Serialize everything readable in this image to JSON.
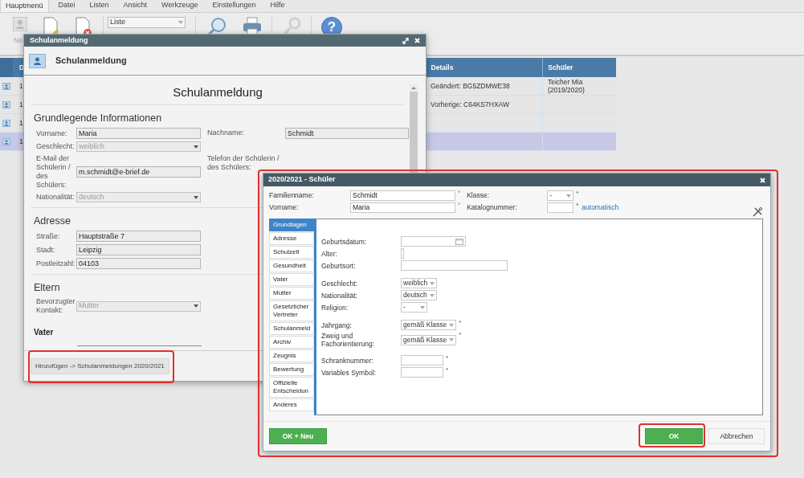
{
  "menu": [
    {
      "label": "Hauptmenü",
      "selected": true
    },
    {
      "label": "Datei",
      "selected": false
    },
    {
      "label": "Listen",
      "selected": false
    },
    {
      "label": "Ansicht",
      "selected": false
    },
    {
      "label": "Werkzeuge",
      "selected": false
    },
    {
      "label": "Einstellungen",
      "selected": false
    },
    {
      "label": "Hilfe",
      "selected": false
    }
  ],
  "toolbar": {
    "groups": [
      [
        {
          "kind": "new-person",
          "disabled": true,
          "label": "Ne"
        },
        {
          "kind": "edit",
          "disabled": false
        },
        {
          "kind": "delete",
          "disabled": false
        }
      ],
      [
        {
          "kind": "dropdown",
          "value": "Liste"
        }
      ],
      [
        {
          "kind": "search",
          "disabled": false
        },
        {
          "kind": "print",
          "disabled": false
        }
      ],
      [
        {
          "kind": "key",
          "disabled": true
        }
      ],
      [
        {
          "kind": "help",
          "disabled": false,
          "glyph": "?"
        }
      ]
    ]
  },
  "table": {
    "columns": {
      "column_2": "D",
      "details": "Details",
      "schueler": "Schüler"
    },
    "rows": [
      {
        "selected": false,
        "column_2": "1",
        "details": "Geändert: BG5ZDMWE38",
        "schueler": "Teicher Mia (2019/2020)"
      },
      {
        "selected": false,
        "column_2": "1",
        "details": "Vorherige: C64KS7HXAW"
      },
      {
        "selected": false,
        "column_2": "1"
      },
      {
        "selected": true,
        "column_2": "1"
      }
    ]
  },
  "registration_dialog": {
    "title": "Schulanmeldung",
    "header": "Schulanmeldung",
    "form_title": "Schulanmeldung",
    "sections": [
      {
        "title": "Grundlegende Informationen",
        "rows": [
          {
            "left": {
              "label": "Vorname:",
              "kind": "text",
              "value": "Maria"
            },
            "right": {
              "label": "Nachname:",
              "kind": "text",
              "value": "Schmidt"
            }
          },
          {
            "left": {
              "label": "Geschlecht:",
              "kind": "select",
              "value": "weiblich",
              "disabled": true
            }
          },
          {
            "left": {
              "label": "E-Mail der Schülerin / des Schülers:",
              "kind": "text",
              "value": "m.schmidt@e-brief.de"
            },
            "right": {
              "label": "Telefon der Schülerin / des Schülers:",
              "kind": "label"
            }
          },
          {
            "left": {
              "label": "Nationalität:",
              "kind": "select",
              "value": "deutsch",
              "disabled": true
            }
          }
        ]
      },
      {
        "title": "Adresse",
        "rows": [
          {
            "left": {
              "label": "Straße:",
              "kind": "text",
              "value": "Hauptstraße 7"
            }
          },
          {
            "left": {
              "label": "Stadt:",
              "kind": "text",
              "value": "Leipzig"
            }
          },
          {
            "left": {
              "label": "Postleitzahl:",
              "kind": "text",
              "value": "04103"
            }
          }
        ]
      },
      {
        "title": "Eltern",
        "rows": [
          {
            "left": {
              "label": "Bevorzugter Kontakt:",
              "kind": "select",
              "value": "Mutter",
              "disabled": true
            }
          }
        ],
        "subsection": "Vater"
      }
    ],
    "footer_button": "Hinzufügen -> Schulanmeldungen 2020/2021"
  },
  "student_dialog": {
    "title": "2020/2021 - Schüler",
    "name_fields": [
      {
        "label": "Familienname:",
        "value": "Schmidt",
        "mark": "°"
      },
      {
        "label": "Vorname:",
        "value": "Maria",
        "mark": "°"
      }
    ],
    "class_fields": [
      {
        "label": "Klasse:",
        "kind": "select",
        "value": "-",
        "mark": "*"
      },
      {
        "label": "Katalognummer:",
        "kind": "text",
        "mark": "*",
        "link": "automatisch"
      }
    ],
    "tabs": [
      {
        "label": "Grundlagen",
        "selected": true
      },
      {
        "label": "Adresse",
        "selected": false
      },
      {
        "label": "Schulzeit",
        "selected": false
      },
      {
        "label": "Gesundheit",
        "selected": false
      },
      {
        "label": "Vater",
        "selected": false
      },
      {
        "label": "Mutter",
        "selected": false
      },
      {
        "label": "Gesetzlicher Vertreter",
        "selected": false
      },
      {
        "label": "Schulanmeld",
        "selected": false
      },
      {
        "label": "Archiv",
        "selected": false
      },
      {
        "label": "Zeugnis",
        "selected": false
      },
      {
        "label": "Bewertung",
        "selected": false
      },
      {
        "label": "Offizielle Entscheidun",
        "selected": false
      },
      {
        "label": "Anderes",
        "selected": false
      }
    ],
    "field_groups": [
      [
        {
          "label": "Geburtsdatum:",
          "kind": "date"
        },
        {
          "label": "Alter:",
          "kind": "narrow"
        },
        {
          "label": "Geburtsort:",
          "kind": "wide"
        }
      ],
      [
        {
          "label": "Geschlecht:",
          "kind": "select",
          "value": "weiblich"
        },
        {
          "label": "Nationalität:",
          "kind": "select",
          "value": "deutsch"
        },
        {
          "label": "Religion:",
          "kind": "select",
          "value": "-"
        }
      ],
      [
        {
          "label": "Jahrgang:",
          "kind": "select-wide",
          "value": "gemäß Klasse",
          "mark": "*"
        },
        {
          "label": "Zweig und Fachorientierung:",
          "kind": "select-wide",
          "value": "gemäß Klasse",
          "mark": "*"
        }
      ],
      [
        {
          "label": "Schranknummer:",
          "kind": "text",
          "mark": "*"
        },
        {
          "label": "Variables Symbol:",
          "kind": "text",
          "mark": "*"
        }
      ]
    ],
    "buttons": {
      "ok_new": "OK + Neu",
      "ok": "OK",
      "cancel": "Abbrechen"
    }
  }
}
